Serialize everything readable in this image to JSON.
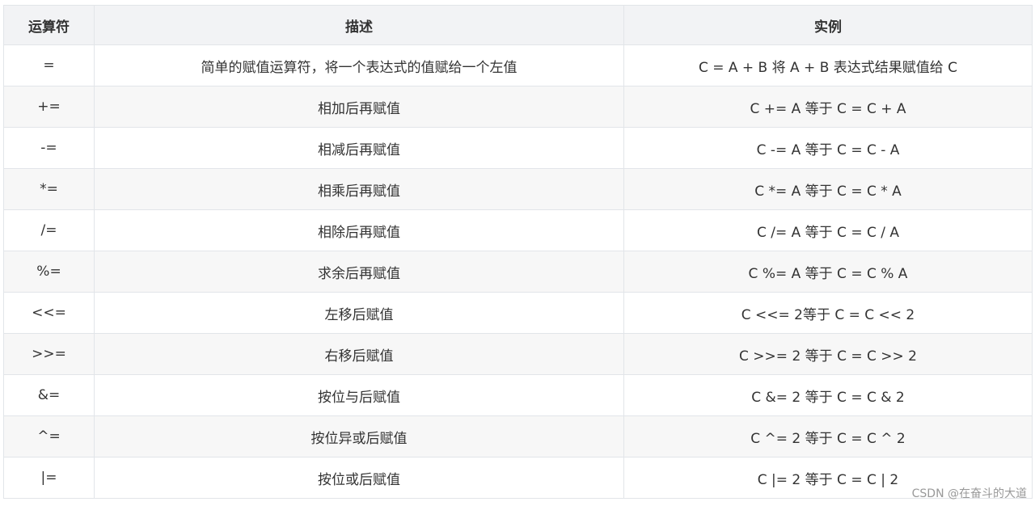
{
  "table": {
    "headers": [
      "运算符",
      "描述",
      "实例"
    ],
    "rows": [
      [
        "=",
        "简单的赋值运算符，将一个表达式的值赋给一个左值",
        "C = A + B 将 A + B 表达式结果赋值给 C"
      ],
      [
        "+=",
        "相加后再赋值",
        "C += A 等于 C = C + A"
      ],
      [
        "-=",
        "相减后再赋值",
        "C -= A 等于 C = C - A"
      ],
      [
        "*=",
        "相乘后再赋值",
        "C *= A 等于 C = C * A"
      ],
      [
        "/=",
        "相除后再赋值",
        "C /= A 等于 C = C / A"
      ],
      [
        "%=",
        "求余后再赋值",
        "C %= A 等于 C = C % A"
      ],
      [
        "<<=",
        "左移后赋值",
        "C <<= 2等于 C = C << 2"
      ],
      [
        ">>=",
        "右移后赋值",
        "C >>= 2 等于 C = C >> 2"
      ],
      [
        "&=",
        "按位与后赋值",
        "C &= 2 等于 C = C & 2"
      ],
      [
        "^=",
        "按位异或后赋值",
        "C ^= 2 等于 C = C ^ 2"
      ],
      [
        "|=",
        "按位或后赋值",
        "C |= 2 等于 C = C | 2"
      ]
    ]
  },
  "watermark": "CSDN @在奋斗的大道"
}
